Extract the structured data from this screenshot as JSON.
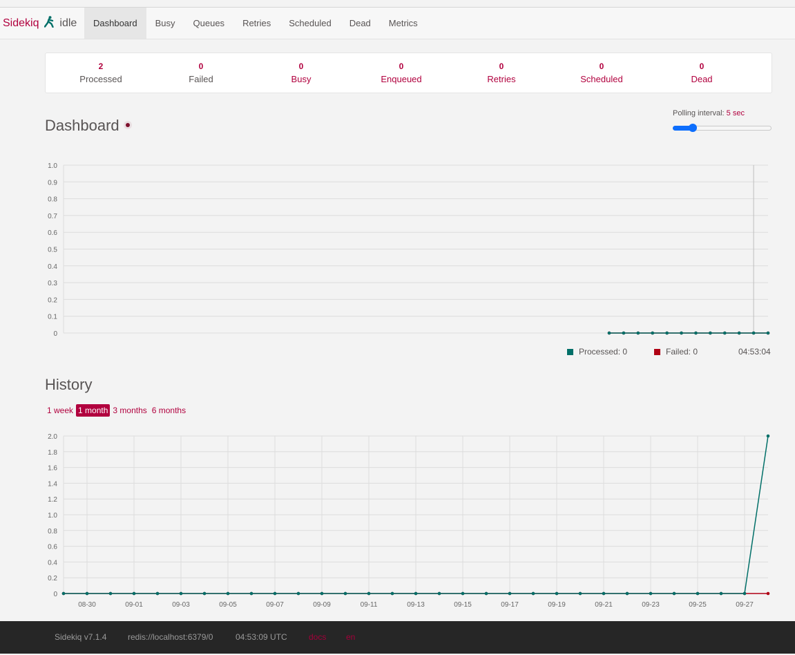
{
  "app": {
    "name": "Sidekiq",
    "status": "idle",
    "icon": "sidekiq-kicker-icon"
  },
  "nav": {
    "items": [
      "Dashboard",
      "Busy",
      "Queues",
      "Retries",
      "Scheduled",
      "Dead",
      "Metrics"
    ],
    "active": "Dashboard"
  },
  "stats": [
    {
      "value": "2",
      "label": "Processed"
    },
    {
      "value": "0",
      "label": "Failed"
    },
    {
      "value": "0",
      "label": "Busy"
    },
    {
      "value": "0",
      "label": "Enqueued"
    },
    {
      "value": "0",
      "label": "Retries"
    },
    {
      "value": "0",
      "label": "Scheduled"
    },
    {
      "value": "0",
      "label": "Dead"
    }
  ],
  "dashboard": {
    "title": "Dashboard",
    "polling_label": "Polling interval:",
    "polling_value": "5 sec",
    "polling_fraction": 0.2
  },
  "realtime": {
    "legend": {
      "processed": "Processed: 0",
      "failed": "Failed: 0",
      "time": "04:53:04"
    }
  },
  "history": {
    "title": "History",
    "ranges": [
      "1 week",
      "1 month",
      "3 months",
      "6 months"
    ],
    "active_range": "1 month"
  },
  "footer": {
    "version": "Sidekiq v7.1.4",
    "redis": "redis://localhost:6379/0",
    "time": "04:53:09 UTC",
    "docs": "docs",
    "locale": "en"
  },
  "colors": {
    "accent": "#b1003e",
    "processed": "#006f68",
    "failed": "#af0014",
    "footer_bg": "#262626"
  },
  "chart_data": [
    {
      "type": "line",
      "series": [
        {
          "name": "Processed",
          "values": [
            0,
            0,
            0,
            0,
            0,
            0,
            0,
            0,
            0,
            0,
            0,
            0
          ]
        },
        {
          "name": "Failed",
          "values": [
            0,
            0,
            0,
            0,
            0,
            0,
            0,
            0,
            0,
            0,
            0,
            0
          ]
        }
      ],
      "ylim": [
        0,
        1.0
      ],
      "yticks": [
        "0",
        "0.1",
        "0.2",
        "0.3",
        "0.4",
        "0.5",
        "0.6",
        "0.7",
        "0.8",
        "0.9",
        "1.0"
      ],
      "grid": true
    },
    {
      "type": "line",
      "x": [
        "08-29",
        "08-30",
        "08-31",
        "09-01",
        "09-02",
        "09-03",
        "09-04",
        "09-05",
        "09-06",
        "09-07",
        "09-08",
        "09-09",
        "09-10",
        "09-11",
        "09-12",
        "09-13",
        "09-14",
        "09-15",
        "09-16",
        "09-17",
        "09-18",
        "09-19",
        "09-20",
        "09-21",
        "09-22",
        "09-23",
        "09-24",
        "09-25",
        "09-26",
        "09-27",
        "09-28"
      ],
      "xticks": [
        "08-30",
        "09-01",
        "09-03",
        "09-05",
        "09-07",
        "09-09",
        "09-11",
        "09-13",
        "09-15",
        "09-17",
        "09-19",
        "09-21",
        "09-23",
        "09-25",
        "09-27"
      ],
      "series": [
        {
          "name": "Processed",
          "values": [
            0,
            0,
            0,
            0,
            0,
            0,
            0,
            0,
            0,
            0,
            0,
            0,
            0,
            0,
            0,
            0,
            0,
            0,
            0,
            0,
            0,
            0,
            0,
            0,
            0,
            0,
            0,
            0,
            0,
            0,
            2
          ]
        },
        {
          "name": "Failed",
          "values": [
            0,
            0,
            0,
            0,
            0,
            0,
            0,
            0,
            0,
            0,
            0,
            0,
            0,
            0,
            0,
            0,
            0,
            0,
            0,
            0,
            0,
            0,
            0,
            0,
            0,
            0,
            0,
            0,
            0,
            0,
            0
          ]
        }
      ],
      "ylim": [
        0,
        2.0
      ],
      "yticks": [
        "0",
        "0.2",
        "0.4",
        "0.6",
        "0.8",
        "1.0",
        "1.2",
        "1.4",
        "1.6",
        "1.8",
        "2.0"
      ],
      "grid": true
    }
  ]
}
